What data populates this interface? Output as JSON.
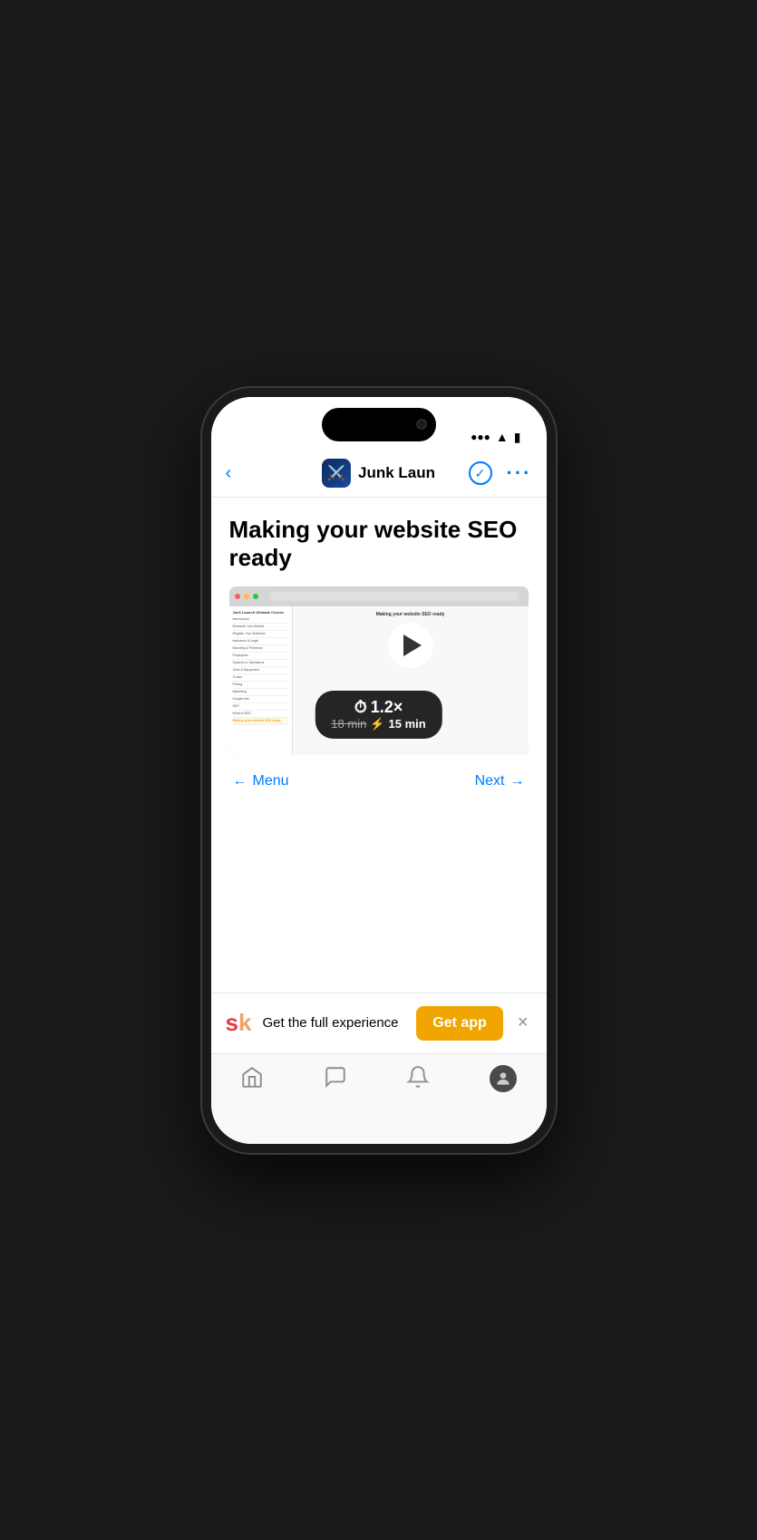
{
  "page": {
    "title": "Making your website SEO ready",
    "back_label": "Menu",
    "next_label": "Next"
  },
  "nav": {
    "app_name": "Junk Laun",
    "app_icon_emoji": "⚔️",
    "check_icon": "✓",
    "more_icon": "···"
  },
  "video": {
    "speed_value": "1.2×",
    "original_time": "18 min",
    "lightning_icon": "⚡",
    "new_time": "15 min"
  },
  "browser_sim": {
    "course_title": "Junk Launch Ultimate Course",
    "sidebar_items": [
      "Introduction",
      "Research Your Market",
      "Register Your Business",
      "Insurance & Legal",
      "Branding & Presence",
      "Employees",
      "Systems & Operations",
      "Tools & Equipment",
      "Trucks",
      "Pricing",
      "Marketing",
      "Google Ads",
      "SEO",
      "What is SEO",
      "Making your website SEO ready"
    ],
    "lesson_title": "Making your website SEO ready"
  },
  "banner": {
    "text": "Get the full experience",
    "cta_label": "Get app",
    "close_icon": "×"
  },
  "tabs": [
    {
      "name": "home",
      "icon": "⌂"
    },
    {
      "name": "chat",
      "icon": "💬"
    },
    {
      "name": "bell",
      "icon": "🔔"
    },
    {
      "name": "profile",
      "icon": "👤"
    }
  ]
}
